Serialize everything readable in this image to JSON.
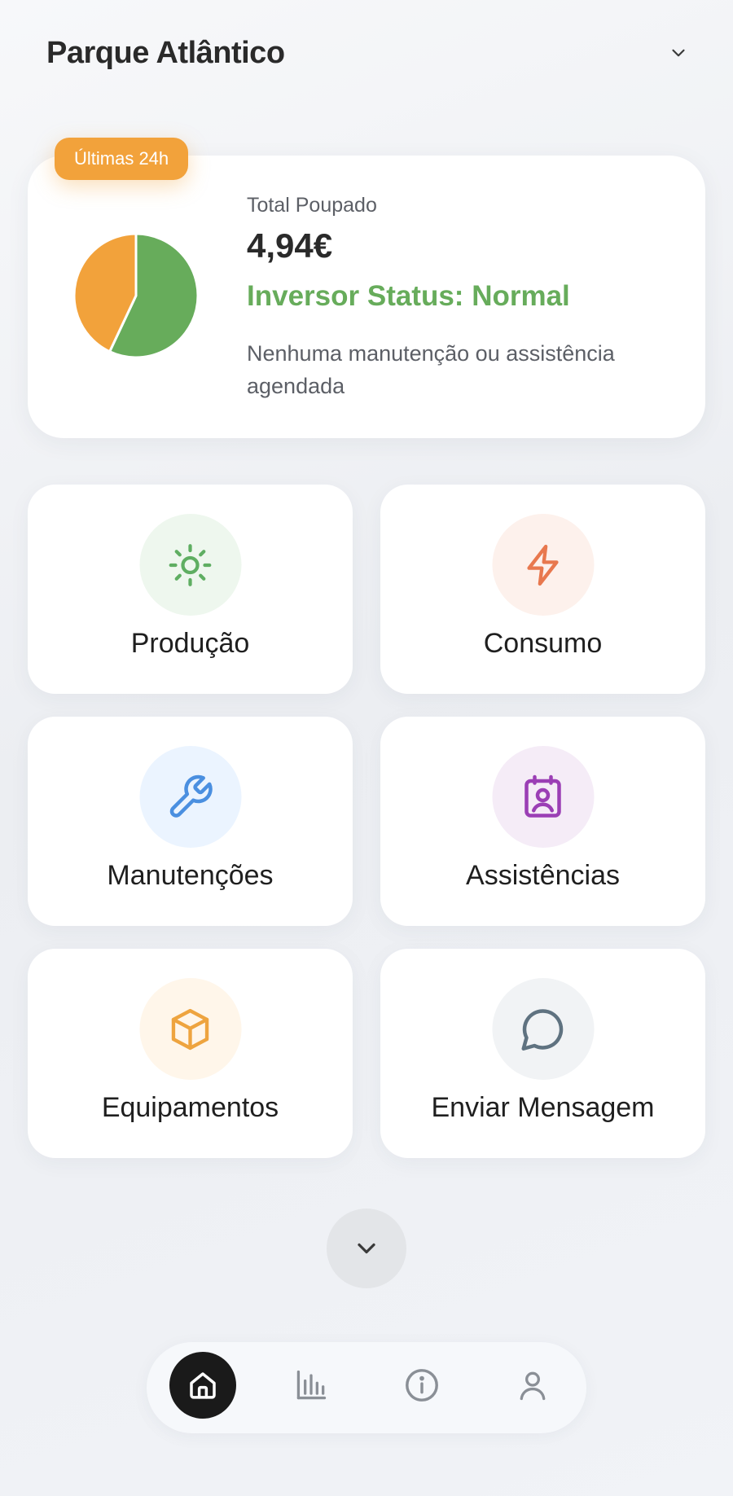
{
  "header": {
    "site_name": "Parque Atlântico",
    "chevron_icon": "chevron-down-icon"
  },
  "summary": {
    "period_badge": "Últimas 24h",
    "total_label": "Total Poupado",
    "total_value": "4,94€",
    "status_text": "Inversor Status: Normal",
    "note": "Nenhuma manutenção ou assistência agendada",
    "colors": {
      "accent_orange": "#f2a23b",
      "status_green": "#67ac5b"
    }
  },
  "chart_data": {
    "type": "pie",
    "categories": [
      "",
      ""
    ],
    "values": [
      57,
      43
    ],
    "colors": [
      "#67ac5b",
      "#f2a23b"
    ]
  },
  "tiles": [
    {
      "label": "Produção",
      "icon": "sun-icon",
      "color": "#5fae62",
      "bg": "#eef7ee"
    },
    {
      "label": "Consumo",
      "icon": "lightning-icon",
      "color": "#e8784e",
      "bg": "#fdf1ec"
    },
    {
      "label": "Manutenções",
      "icon": "wrench-icon",
      "color": "#4a8fe0",
      "bg": "#ebf4ff"
    },
    {
      "label": "Assistências",
      "icon": "contact-calendar-icon",
      "color": "#9b3fb5",
      "bg": "#f5ecf7"
    },
    {
      "label": "Equipamentos",
      "icon": "box-icon",
      "color": "#eea43f",
      "bg": "#fff6ea"
    },
    {
      "label": "Enviar Mensagem",
      "icon": "chat-bubble-icon",
      "color": "#5f7280",
      "bg": "#f1f3f5"
    }
  ],
  "more_button_icon": "chevron-down-icon",
  "bottom_nav": {
    "items": [
      {
        "icon": "home-icon",
        "active": true
      },
      {
        "icon": "bar-chart-icon",
        "active": false
      },
      {
        "icon": "info-icon",
        "active": false
      },
      {
        "icon": "user-icon",
        "active": false
      }
    ]
  }
}
